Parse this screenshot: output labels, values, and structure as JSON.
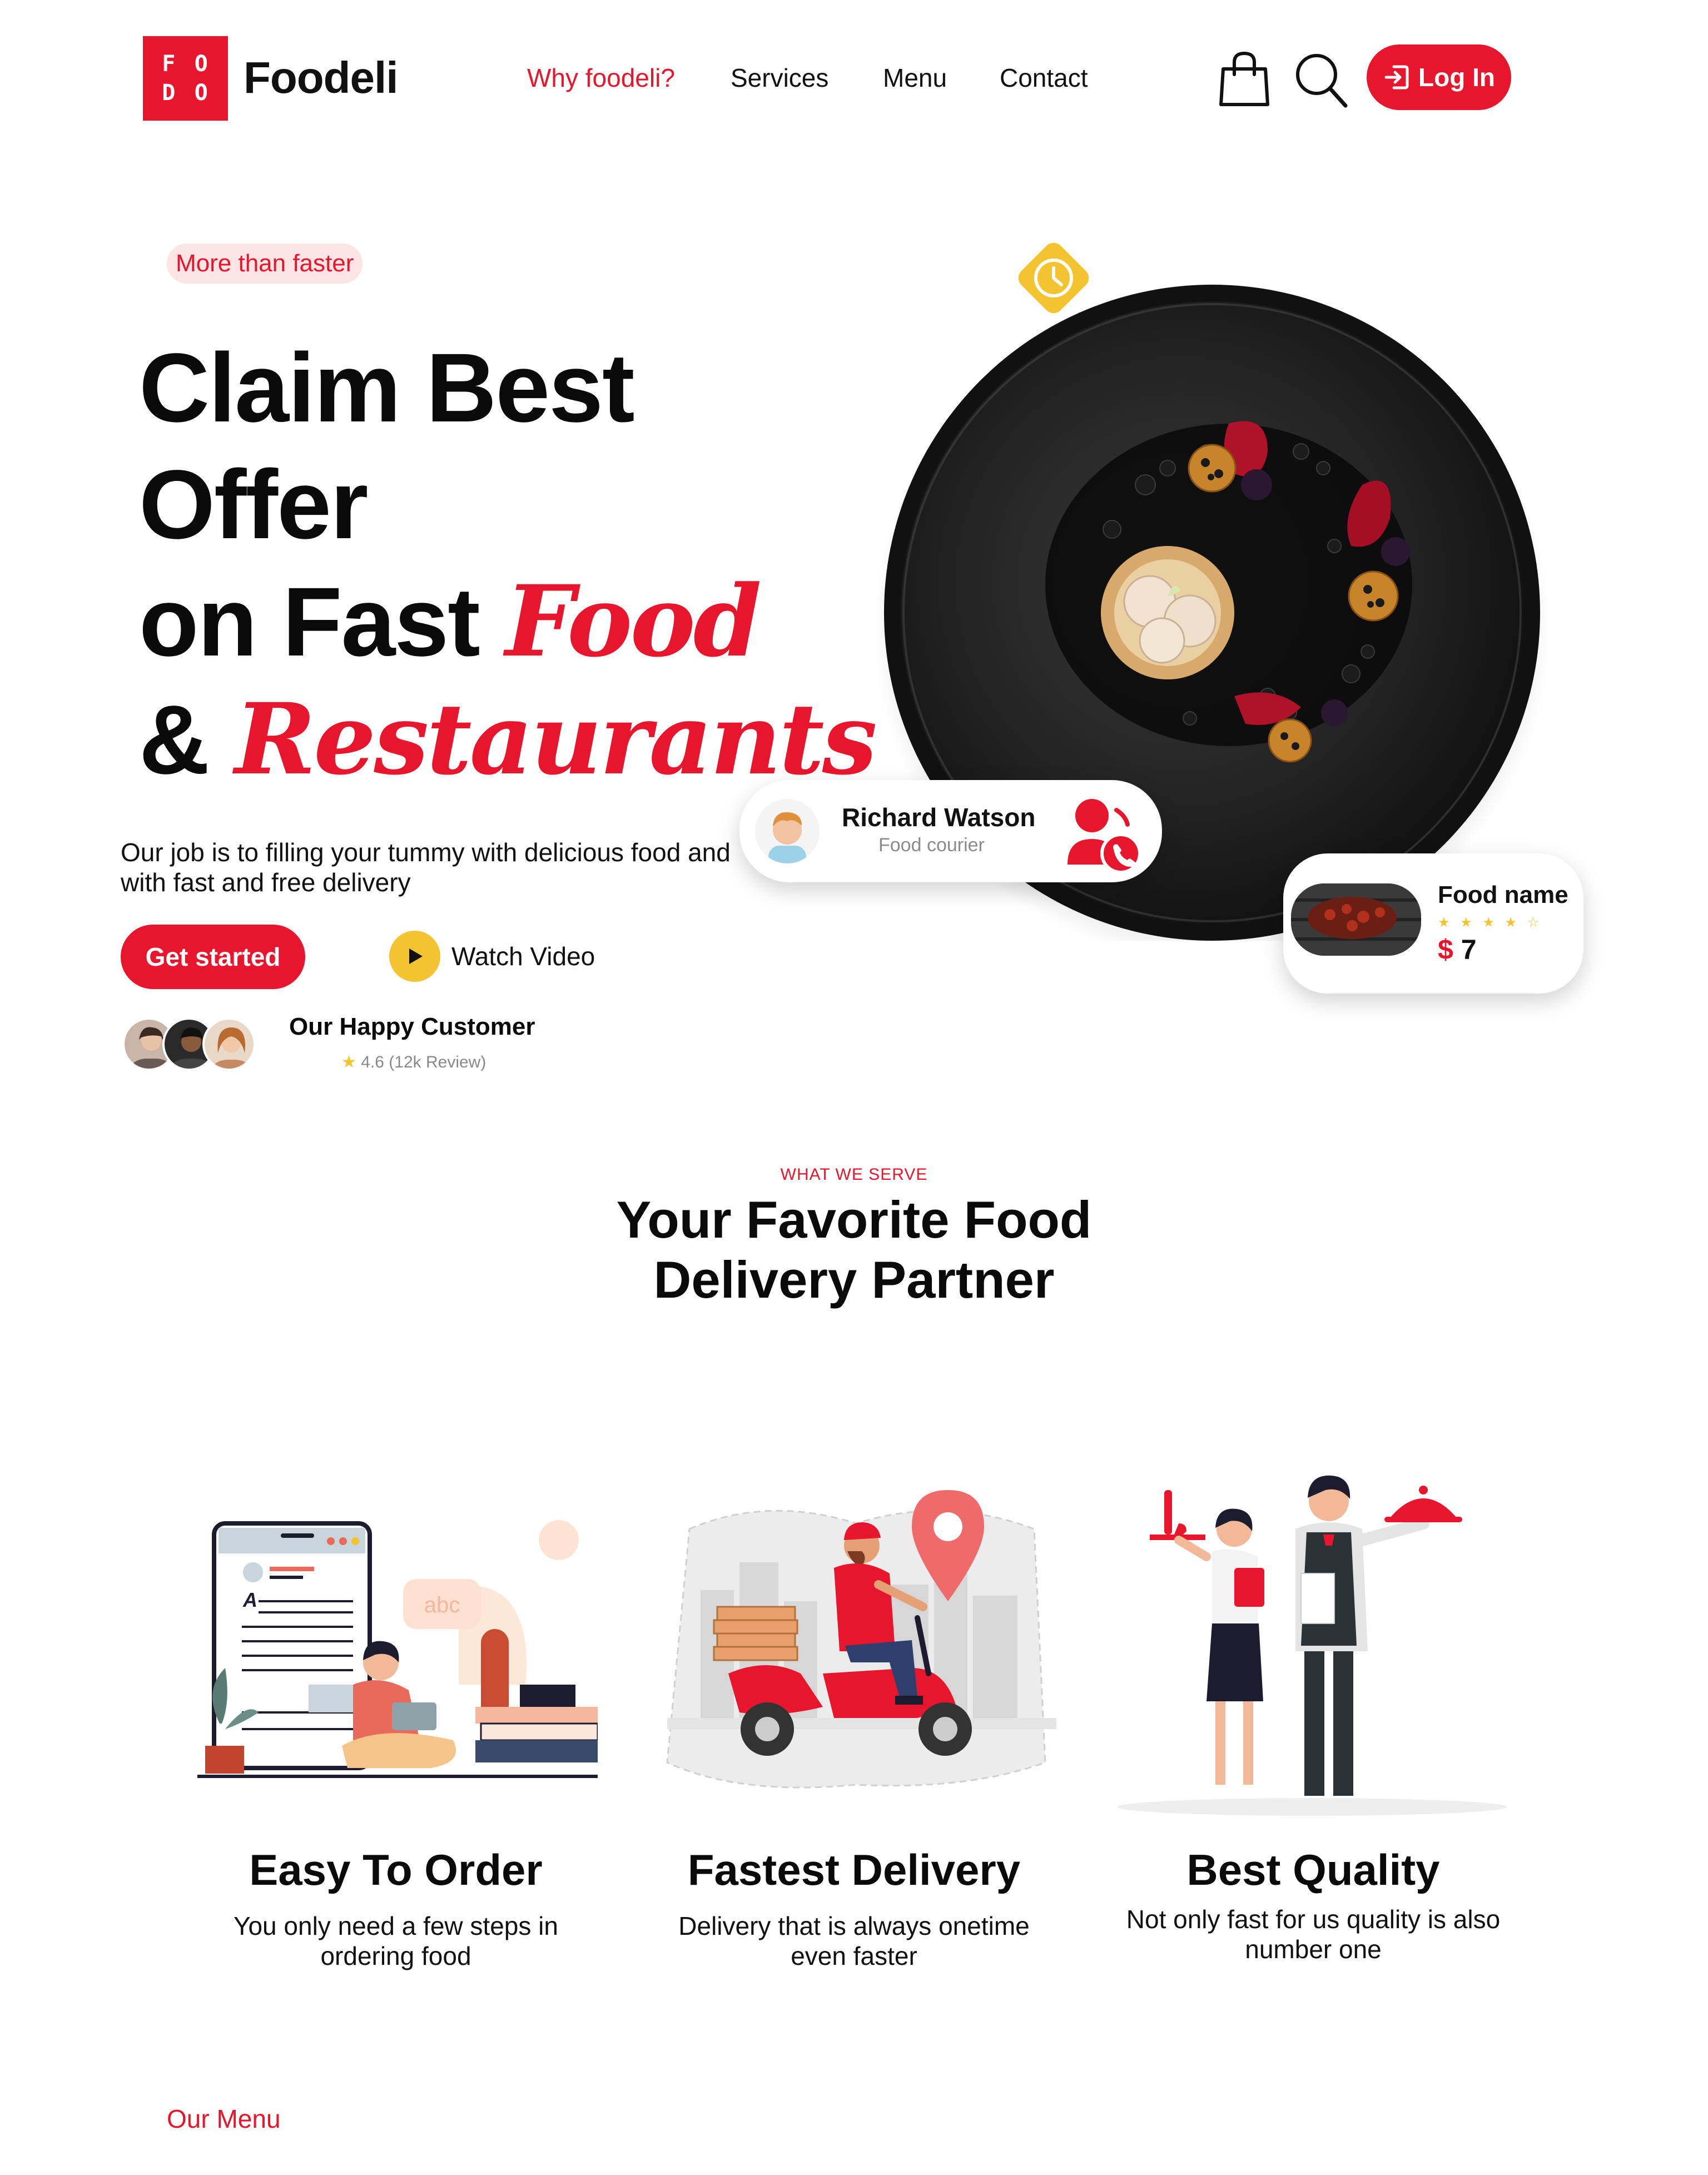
{
  "nav": {
    "logo_letters": [
      "F",
      "O",
      "D",
      "O"
    ],
    "brand": "Foodeli",
    "links": [
      "Why foodeli?",
      "Services",
      "Menu",
      "Contact"
    ],
    "active_index": 0,
    "icons": [
      "shopping-bag-icon",
      "search-icon",
      "login-icon"
    ],
    "login_label": "Log In"
  },
  "hero": {
    "pill": "More than faster",
    "line1": "Claim Best",
    "line2": "Offer",
    "line3_plain": "on Fast ",
    "line3_script": "Food",
    "line4_plain": "& ",
    "line4_script": "Restaurants",
    "description": "Our job is to filling your tummy with delicious food and with fast and free delivery",
    "cta_label": "Get started",
    "watch_label": "Watch Video",
    "customers_title": "Our Happy Customer",
    "rating_text": "4.6 (12k Review)",
    "rating_star": "★"
  },
  "courier": {
    "name": "Richard Watson",
    "role": "Food courier"
  },
  "food_card": {
    "name": "Food name",
    "stars": "★ ★ ★ ★ ☆",
    "currency": "$",
    "price": "7"
  },
  "serve": {
    "eyebrow": "WHAT WE SERVE",
    "title_line1": "Your Favorite Food",
    "title_line2": "Delivery Partner"
  },
  "features": [
    {
      "title": "Easy To Order",
      "desc_line1": "You only need a few steps in",
      "desc_line2": "ordering food"
    },
    {
      "title": "Fastest Delivery",
      "desc_line1": "Delivery that is always onetime",
      "desc_line2": "even faster"
    },
    {
      "title": "Best Quality",
      "desc_line1": "Not only fast for us quality is also",
      "desc_line2": "number one"
    }
  ],
  "illustration_text": {
    "bubble": "abc",
    "doc_letter": "A"
  },
  "menu_label": "Our Menu",
  "colors": {
    "accent": "#e8162d",
    "yellow": "#f4c430",
    "pill_bg": "#fde4e4"
  }
}
